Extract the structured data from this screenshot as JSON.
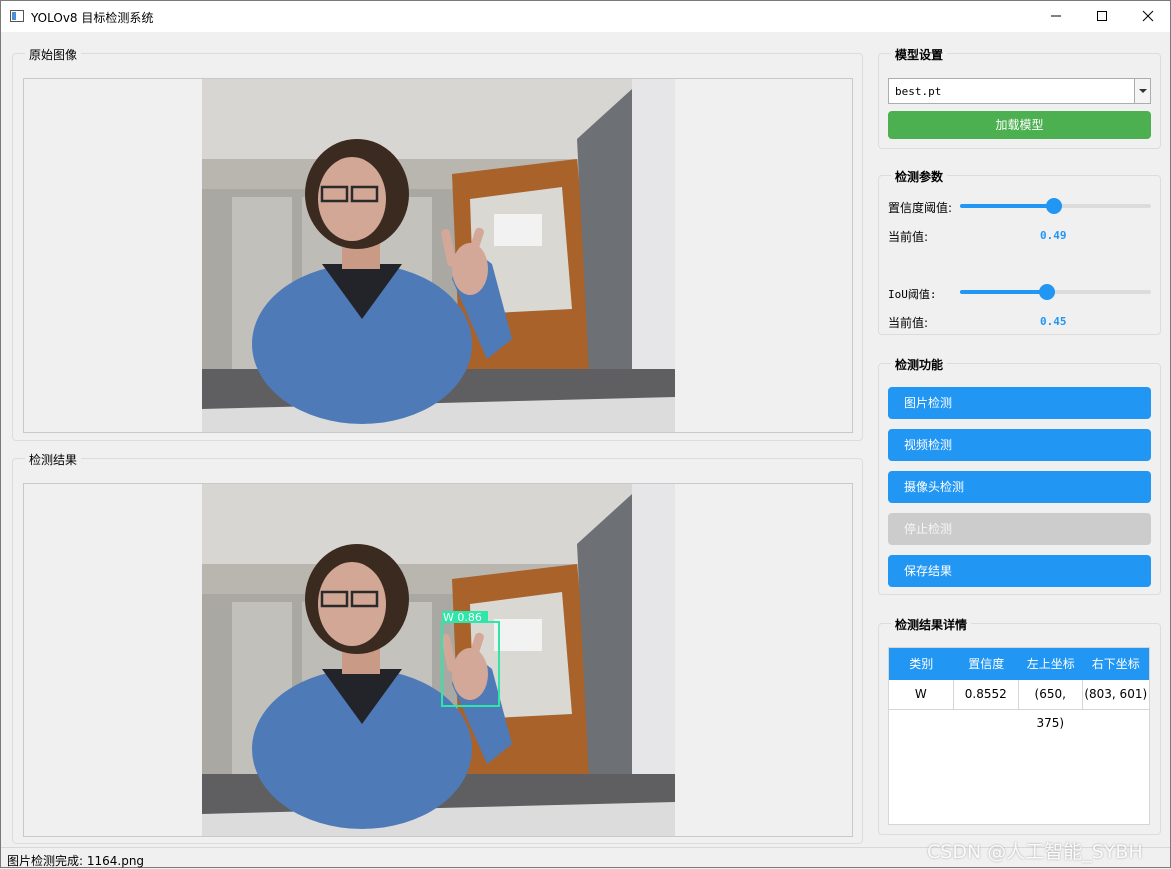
{
  "window": {
    "title": "YOLOv8 目标检测系统"
  },
  "original_panel": {
    "title": "原始图像"
  },
  "result_panel": {
    "title": "检测结果",
    "detection_label": "W 0.86"
  },
  "model_settings": {
    "title": "模型设置",
    "model_selected": "best.pt",
    "load_button": "加载模型"
  },
  "detection_params": {
    "title": "检测参数",
    "confidence_label": "置信度阈值:",
    "confidence_current_label": "当前值:",
    "confidence_value": "0.49",
    "confidence_level": 0.49,
    "iou_label": "IoU阈值:",
    "iou_current_label": "当前值:",
    "iou_value": "0.45",
    "iou_level": 0.45
  },
  "detection_functions": {
    "title": "检测功能",
    "image_button": "图片检测",
    "video_button": "视频检测",
    "camera_button": "摄像头检测",
    "stop_button": "停止检测",
    "save_button": "保存结果"
  },
  "result_details": {
    "title": "检测结果详情",
    "columns": [
      "类别",
      "置信度",
      "左上坐标",
      "右下坐标"
    ],
    "rows": [
      [
        "W",
        "0.8552",
        "(650, 375)",
        "(803, 601)"
      ]
    ]
  },
  "status": {
    "text": "图片检测完成: 1164.png"
  },
  "watermark": "CSDN @人工智能_SYBH",
  "colors": {
    "accent": "#2196f3",
    "load_button": "#4caf50",
    "disabled": "#cccccc",
    "detection_box": "#2ee6a8"
  }
}
